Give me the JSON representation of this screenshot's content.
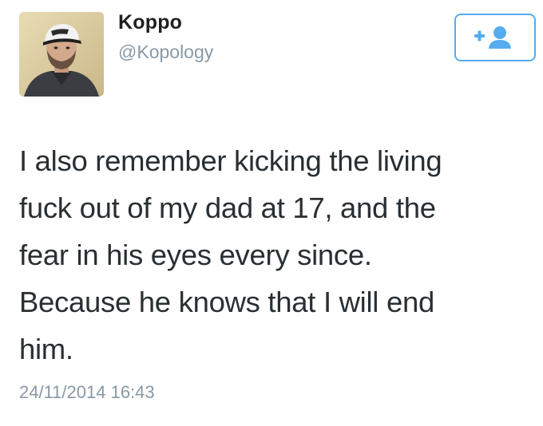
{
  "user": {
    "display_name": "Koppo",
    "handle": "@Kopology",
    "avatar_icon": "profile-photo"
  },
  "follow_button": {
    "icon": "add-user-icon",
    "color": "#55acee"
  },
  "tweet": {
    "text": "I also remember kicking the living\nfuck out of my dad at 17, and the\nfear in his eyes every since.\nBecause he knows that I will end\nhim.",
    "timestamp": "24/11/2014 16:43"
  },
  "colors": {
    "text": "#292f33",
    "muted": "#8899a6",
    "accent": "#55acee"
  }
}
